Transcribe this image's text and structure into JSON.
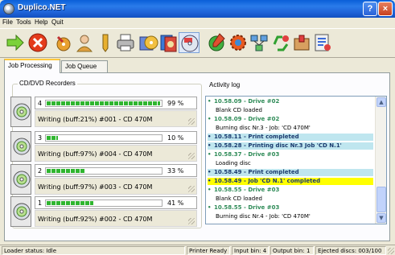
{
  "window": {
    "title": "Duplico.NET",
    "help_label": "?",
    "close_label": "×"
  },
  "menu": {
    "items": [
      "File",
      "Tools",
      "Help",
      "Quit"
    ]
  },
  "toolbar": {
    "icons": [
      "go-arrow-icon",
      "stop-icon",
      "burn-settings-icon",
      "user-icon",
      "pen-icon",
      "printer-icon",
      "disc-print-icon",
      "disc-stack-icon",
      "disc-label-icon",
      "pencil-disc-icon",
      "gear-icon",
      "network-icon",
      "recycle-icon",
      "package-icon",
      "settings-icon"
    ]
  },
  "tabs": [
    "Job Processing",
    "Job Queue"
  ],
  "recorders_group": {
    "title": "CD/DVD Recorders"
  },
  "recorders": [
    {
      "num": "4",
      "percent": "99 %",
      "progress": 0.99,
      "status": "Writing (buff:21%)",
      "job": "#001 - CD 470M"
    },
    {
      "num": "3",
      "percent": "10 %",
      "progress": 0.1,
      "status": "Writing (buff:97%)",
      "job": "#004 - CD 470M"
    },
    {
      "num": "2",
      "percent": "33 %",
      "progress": 0.33,
      "status": "Writing (buff:97%)",
      "job": "#003 - CD 470M"
    },
    {
      "num": "1",
      "percent": "41 %",
      "progress": 0.41,
      "status": "Writing (buff:92%)",
      "job": "#002 - CD 470M"
    }
  ],
  "log_group": {
    "title": "Activity log"
  },
  "log": [
    {
      "type": "entry",
      "text": "10.58.09 - Drive #02"
    },
    {
      "type": "detail",
      "text": "Blank CD loaded"
    },
    {
      "type": "entry",
      "text": "10.58.09 - Drive #02"
    },
    {
      "type": "detail",
      "text": "Burning disc Nr.3 - Job: 'CD 470M'"
    },
    {
      "type": "hl-cyan",
      "text": "10.58.11 - Print completed"
    },
    {
      "type": "hl-cyan",
      "text": "10.58.28 - Printing disc Nr.3 Job 'CD N.1'"
    },
    {
      "type": "entry",
      "text": "10.58.37 - Drive #03"
    },
    {
      "type": "detail",
      "text": "Loading disc"
    },
    {
      "type": "hl-cyan",
      "text": "10.58.49 - Print completed"
    },
    {
      "type": "hl-yellow",
      "text": "10.58.49 - Job 'CD N.1' completed"
    },
    {
      "type": "entry",
      "text": "10.58.55 - Drive #03"
    },
    {
      "type": "detail",
      "text": "Blank CD loaded"
    },
    {
      "type": "entry",
      "text": "10.58.55 - Drive #03"
    },
    {
      "type": "detail",
      "text": "Burning disc Nr.4 - Job: 'CD 470M'"
    }
  ],
  "statusbar": {
    "loader": "Loader status: Idle",
    "printer": "Printer Ready",
    "input": "Input bin: 4",
    "output": "Output bin: 1",
    "ejected": "Ejected discs: 003/100"
  }
}
